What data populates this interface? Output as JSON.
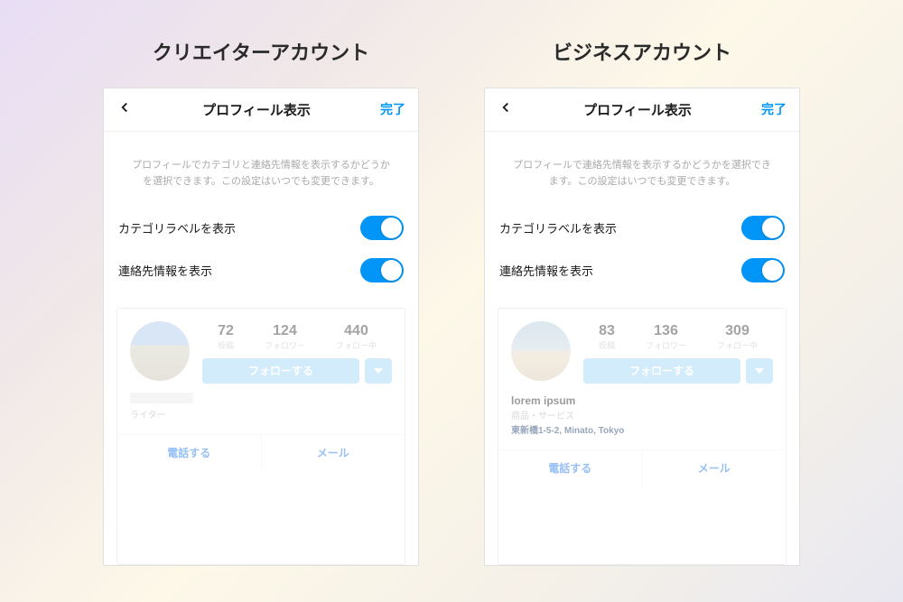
{
  "left": {
    "title": "クリエイターアカウント",
    "nav_title": "プロフィール表示",
    "done": "完了",
    "description": "プロフィールでカテゴリと連絡先情報を表示するかどうかを選択できます。この設定はいつでも変更できます。",
    "toggle1_label": "カテゴリラベルを表示",
    "toggle2_label": "連絡先情報を表示",
    "stats": {
      "posts_num": "72",
      "posts_lab": "投稿",
      "followers_num": "124",
      "followers_lab": "フォロワー",
      "following_num": "440",
      "following_lab": "フォロー中"
    },
    "follow_label": "フォローする",
    "category": "ライター",
    "call": "電話する",
    "mail": "メール"
  },
  "right": {
    "title": "ビジネスアカウント",
    "nav_title": "プロフィール表示",
    "done": "完了",
    "description": "プロフィールで連絡先情報を表示するかどうかを選択できます。この設定はいつでも変更できます。",
    "toggle1_label": "カテゴリラベルを表示",
    "toggle2_label": "連絡先情報を表示",
    "stats": {
      "posts_num": "83",
      "posts_lab": "投稿",
      "followers_num": "136",
      "followers_lab": "フォロワー",
      "following_num": "309",
      "following_lab": "フォロー中"
    },
    "follow_label": "フォローする",
    "name": "lorem ipsum",
    "category": "商品・サービス",
    "address": "東新橋1-5-2, Minato, Tokyo",
    "call": "電話する",
    "mail": "メール"
  }
}
